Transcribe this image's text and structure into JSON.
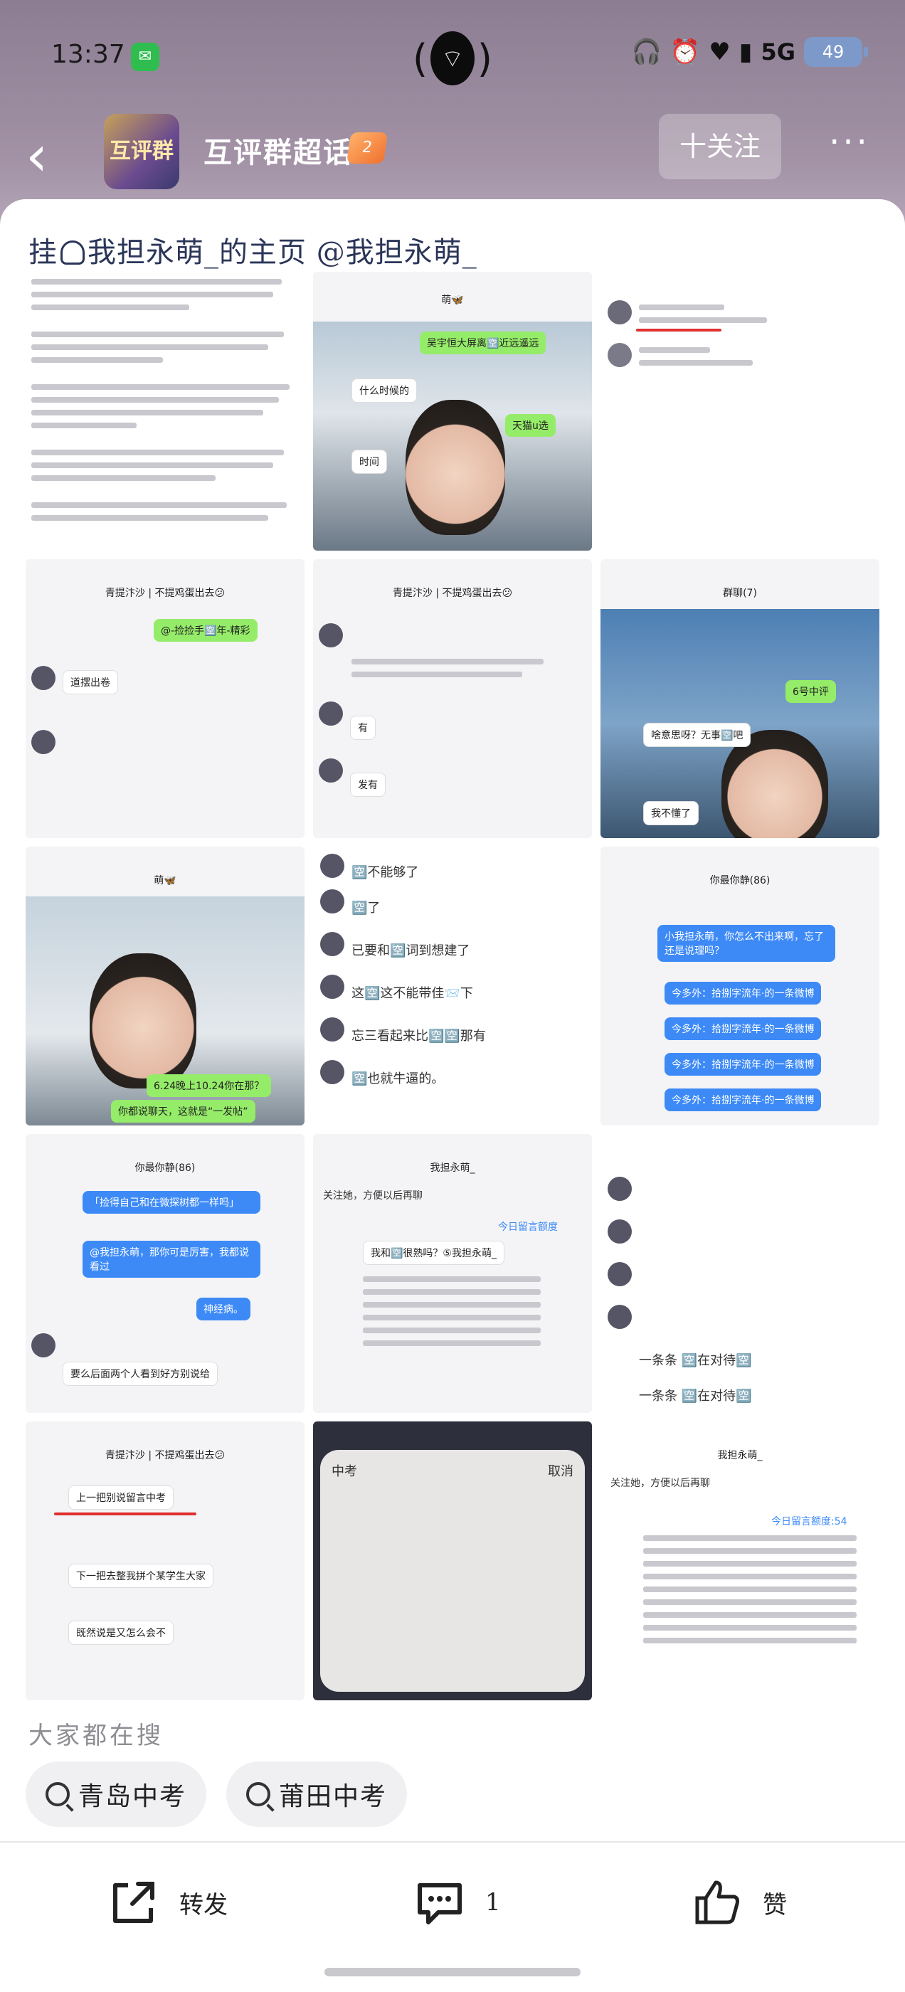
{
  "status_bar": {
    "time": "13:37",
    "network": "5G",
    "battery": "49"
  },
  "header": {
    "back_label": "‹",
    "group_name": "互评群超话",
    "group_avatar_text": "互评群",
    "level": "2",
    "follow_label": "十关注",
    "more_label": "···"
  },
  "post": {
    "title_prefix": "挂",
    "title_rest": "我担永萌_的主页 @我担永萌_",
    "images": [
      {
        "id": "img1",
        "caption": ""
      },
      {
        "id": "img2",
        "header": "萌🦋",
        "bubbles": [
          "吴宇恒大屏离🈳近远遥远",
          "什么时候的",
          "天猫u选",
          "时间"
        ]
      },
      {
        "id": "img3",
        "caption": ""
      },
      {
        "id": "img4",
        "header": "青提汴沙 | 不提鸡蛋出去😕",
        "bubbles": [
          "@-捡捡手🈳年-精彩",
          "道摆出卷"
        ]
      },
      {
        "id": "img5",
        "header": "青提汴沙 | 不提鸡蛋出去😕",
        "bubbles": [
          "有",
          "发有"
        ]
      },
      {
        "id": "img6",
        "header": "群聊(7)",
        "bubbles": [
          "6号中评",
          "啥意思呀？无事🈳吧",
          "我不懂了"
        ]
      },
      {
        "id": "img7",
        "header": "萌🦋",
        "bubbles": [
          "6.24晚上10.24你在那？",
          "你都说聊天，这就是“一发帖”"
        ]
      },
      {
        "id": "img8",
        "rows": [
          "🈳不能够了",
          "🈳了",
          "已要和🈳词到想建了",
          "这🈳这不能带佳📨下",
          "忘三看起来比🈳🈳那有",
          "🈳也就牛逼的。"
        ]
      },
      {
        "id": "img9",
        "header": "你最你静(86)",
        "bubbles": [
          "小我担永萌，你怎么不出来啊，忘了还是说理吗？",
          "今多外：拾捌字流年·的一条微博",
          "今多外：拾捌字流年·的一条微博",
          "今多外：拾捌字流年·的一条微博",
          "今多外：拾捌字流年·的一条微博"
        ]
      },
      {
        "id": "img10",
        "header": "你最你静(86)",
        "bubbles": [
          "「捡得自己和在微探树都一样吗」",
          "@我担永萌，那你可是厉害，我都说看过",
          "神经病。",
          "要么后面两个人看到好方别说给"
        ]
      },
      {
        "id": "img11",
        "header": "我担永萌_",
        "bubbles": [
          "关注她，方便以后再聊",
          "今日留言额度",
          "我和🈳很熟吗？⑤我担永萌_"
        ]
      },
      {
        "id": "img12",
        "header": "",
        "bubbles": [
          "一条条 🈳在对待🈳",
          "一条条 🈳在对待🈳"
        ]
      },
      {
        "id": "img13",
        "header": "青提汴沙 | 不提鸡蛋出去😕",
        "bubbles": [
          "上一把别说留言中考",
          "下一把去整我拼个某学生大家",
          "既然说是又怎么会不"
        ]
      },
      {
        "id": "img14",
        "header": "中考",
        "bubbles": [
          "取消"
        ]
      },
      {
        "id": "img15",
        "header": "我担永萌_",
        "bubbles": [
          "关注她，方便以后再聊",
          "今日留言额度:54"
        ]
      }
    ]
  },
  "search_section": {
    "title": "大家都在搜",
    "chips": [
      "青岛中考",
      "莆田中考"
    ]
  },
  "actions": {
    "share_label": "转发",
    "comment_count": "1",
    "like_label": "赞"
  }
}
